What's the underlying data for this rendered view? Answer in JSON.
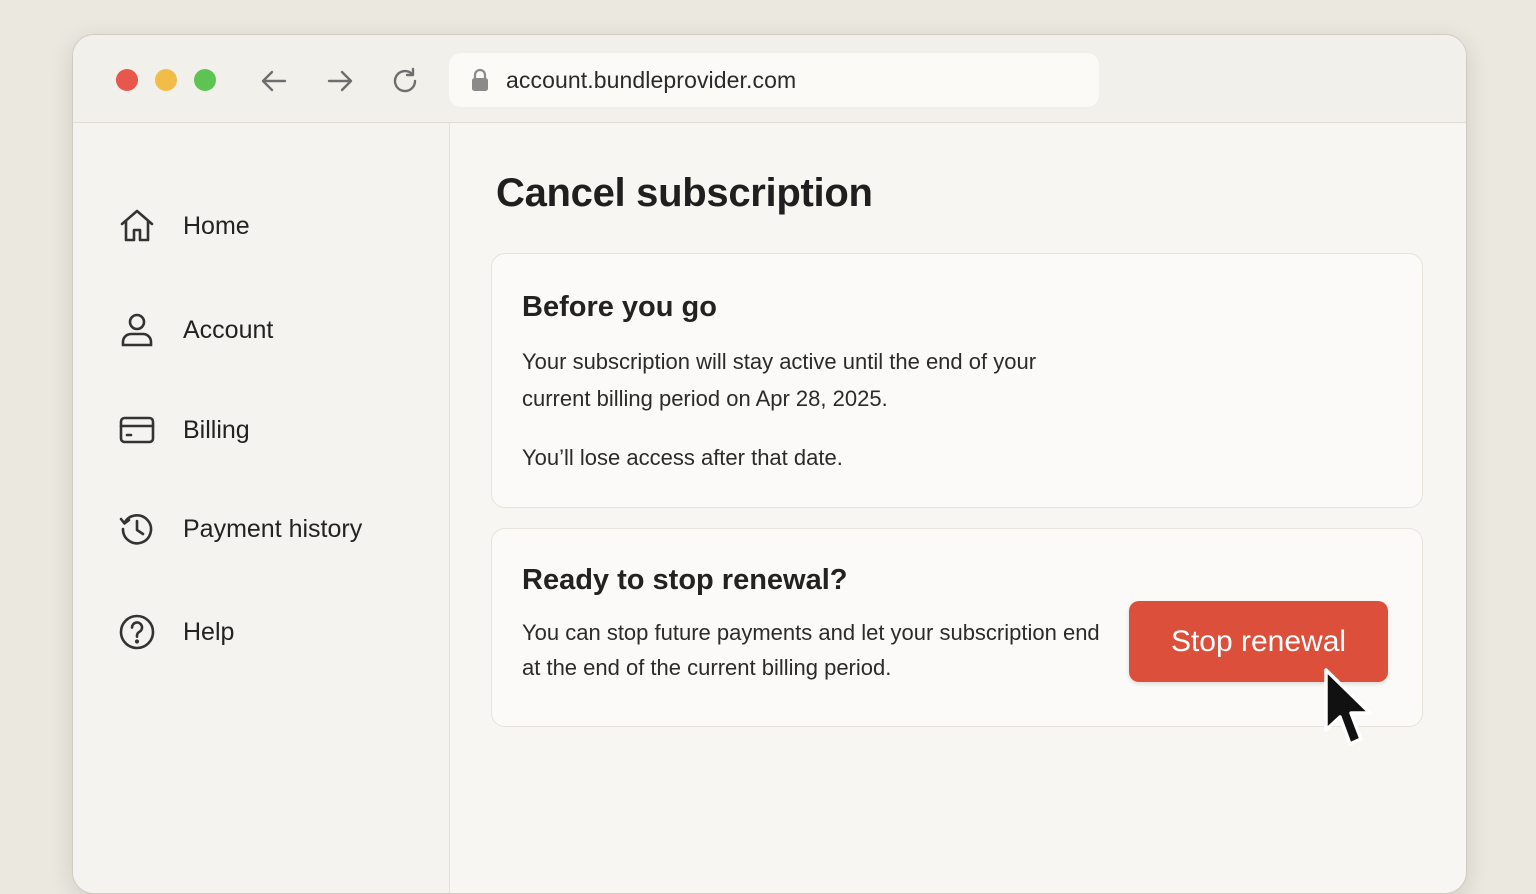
{
  "browser": {
    "url": "account.bundleprovider.com"
  },
  "sidebar": {
    "items": [
      {
        "label": "Home",
        "icon": "home-icon"
      },
      {
        "label": "Account",
        "icon": "user-icon"
      },
      {
        "label": "Billing",
        "icon": "credit-card-icon"
      },
      {
        "label": "Payment history",
        "icon": "history-icon"
      },
      {
        "label": "Help",
        "icon": "help-circle-icon"
      }
    ]
  },
  "main": {
    "title": "Cancel subscription",
    "info_card": {
      "title": "Before you go",
      "text": "Your subscription will stay active until the end of your current billing period on Apr 28, 2025.",
      "note": "You’ll lose access after that date."
    },
    "action_card": {
      "title": "Ready to stop renewal?",
      "text": "You can stop future payments and let your subscription end at the end of the current billing period.",
      "button_label": "Stop renewal"
    }
  },
  "colors": {
    "accent": "#dc4f3a",
    "background": "#ebe8df",
    "window": "#f8f6f2"
  }
}
